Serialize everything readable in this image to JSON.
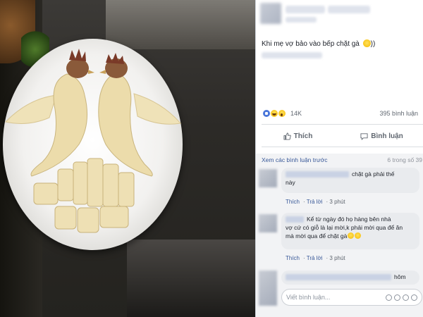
{
  "post": {
    "text": "Khi mẹ vợ bảo vào bếp chặt gà",
    "text_suffix": "))",
    "reaction_count": "14K",
    "comment_count": "395 bình luận"
  },
  "actions": {
    "like_label": "Thích",
    "comment_label": "Bình luận"
  },
  "comments_section": {
    "view_previous": "Xem các bình luận trước",
    "page_count": "6 trong số 39"
  },
  "comments": [
    {
      "text_line1": "chặt gà phải thế",
      "text_line2": "này",
      "like": "Thích",
      "reply": "Trả lời",
      "time": "3 phút"
    },
    {
      "text_line1": "Kể từ ngày đó họ hàng bên nhà",
      "text_line2": "vợ cứ có giỗ là lại mời,k phải mời qua để ăn",
      "text_line3": "mà mời qua để chặt gà",
      "like": "Thích",
      "reply": "Trả lời",
      "time": "3 phút"
    },
    {
      "text_line1": "hôm"
    }
  ],
  "composer": {
    "placeholder": "Viết bình luận..."
  },
  "icons": [
    "like-reaction-icon",
    "laugh-reaction-icon",
    "wow-reaction-icon",
    "thumbs-up-icon",
    "speech-bubble-icon",
    "emoji-icon",
    "camera-icon",
    "gif-icon",
    "sticker-icon"
  ],
  "colors": {
    "link": "#385898",
    "like_blue": "#4a76d9",
    "muted": "#606770",
    "comment_bg": "#e9ebee"
  }
}
